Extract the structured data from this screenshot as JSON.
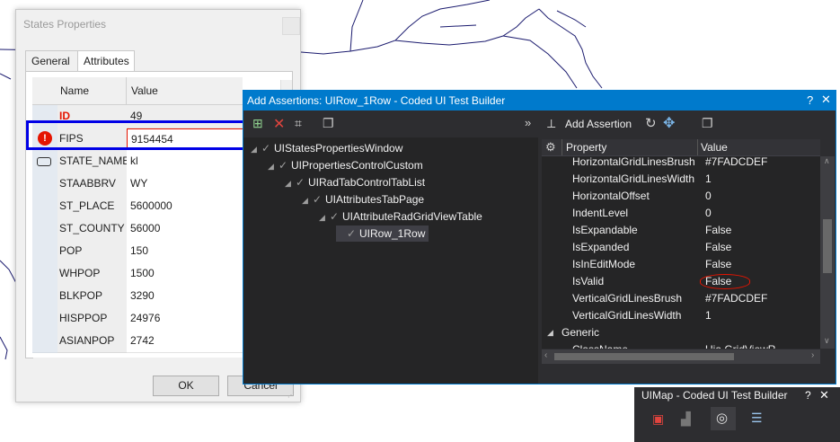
{
  "states_properties": {
    "title": "States Properties",
    "tabs": [
      "General",
      "Attributes"
    ],
    "columns": {
      "name": "Name",
      "value": "Value"
    },
    "rows": [
      {
        "name": "ID",
        "value": "49"
      },
      {
        "name": "FIPS",
        "value": "9154454"
      },
      {
        "name": "STATE_NAME",
        "value": "kl"
      },
      {
        "name": "STAABBRV",
        "value": "WY"
      },
      {
        "name": "ST_PLACE",
        "value": "5600000"
      },
      {
        "name": "ST_COUNTY",
        "value": "56000"
      },
      {
        "name": "POP",
        "value": "150"
      },
      {
        "name": "WHPOP",
        "value": "1500"
      },
      {
        "name": "BLKPOP",
        "value": "3290"
      },
      {
        "name": "HISPPOP",
        "value": "24976"
      },
      {
        "name": "ASIANPOP",
        "value": "2742"
      }
    ],
    "ok_label": "OK",
    "cancel_label": "Cancel"
  },
  "assertions": {
    "title": "Add Assertions: UIRow_1Row - Coded UI Test Builder",
    "add_assertion_label": "Add Assertion",
    "tree": [
      "UIStatesPropertiesWindow",
      "UIPropertiesControlCustom",
      "UIRadTabControlTabList",
      "UIAttributesTabPage",
      "UIAttributeRadGridViewTable",
      "UIRow_1Row"
    ],
    "property_header": "Property",
    "value_header": "Value",
    "properties": [
      {
        "name": "HorizontalGridLinesBrush",
        "value": "#7FADCDEF"
      },
      {
        "name": "HorizontalGridLinesWidth",
        "value": "1"
      },
      {
        "name": "HorizontalOffset",
        "value": "0"
      },
      {
        "name": "IndentLevel",
        "value": "0"
      },
      {
        "name": "IsExpandable",
        "value": "False"
      },
      {
        "name": "IsExpanded",
        "value": "False"
      },
      {
        "name": "IsInEditMode",
        "value": "False"
      },
      {
        "name": "IsValid",
        "value": "False"
      },
      {
        "name": "VerticalGridLinesBrush",
        "value": "#7FADCDEF"
      },
      {
        "name": "VerticalGridLinesWidth",
        "value": "1"
      }
    ],
    "category_generic": "Generic",
    "partial_row": {
      "name": "ClassName",
      "value": "Uia.GridViewR..."
    }
  },
  "uimap": {
    "title": "UIMap - Coded UI Test Builder"
  },
  "icons": {
    "pin": "pin-icon",
    "close": "close-icon",
    "error": "error-icon",
    "refresh": "refresh-icon",
    "crosshair": "crosshair-icon",
    "copy": "copy-icon"
  },
  "colors": {
    "accent": "#007acc",
    "highlight": "#0000e6",
    "error": "#e51400",
    "id_text": "#e51400"
  }
}
